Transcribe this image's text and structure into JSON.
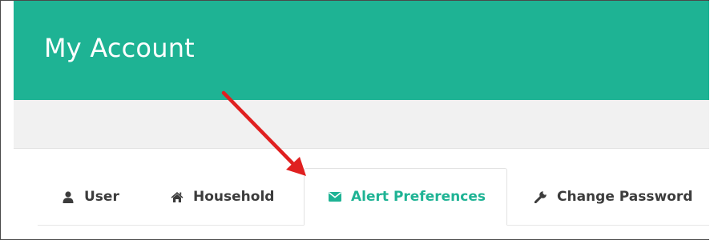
{
  "header": {
    "title": "My Account"
  },
  "tabs": [
    {
      "label": "User",
      "icon": "user-icon"
    },
    {
      "label": "Household",
      "icon": "home-icon"
    },
    {
      "label": "Alert Preferences",
      "icon": "envelope-icon",
      "active": true
    },
    {
      "label": "Change Password",
      "icon": "wrench-icon"
    }
  ],
  "colors": {
    "accent": "#1eb394",
    "header_bg": "#1eb394",
    "band_bg": "#f1f1f1",
    "tab_text": "#3c3c3c",
    "annotation_arrow": "#e02020"
  }
}
